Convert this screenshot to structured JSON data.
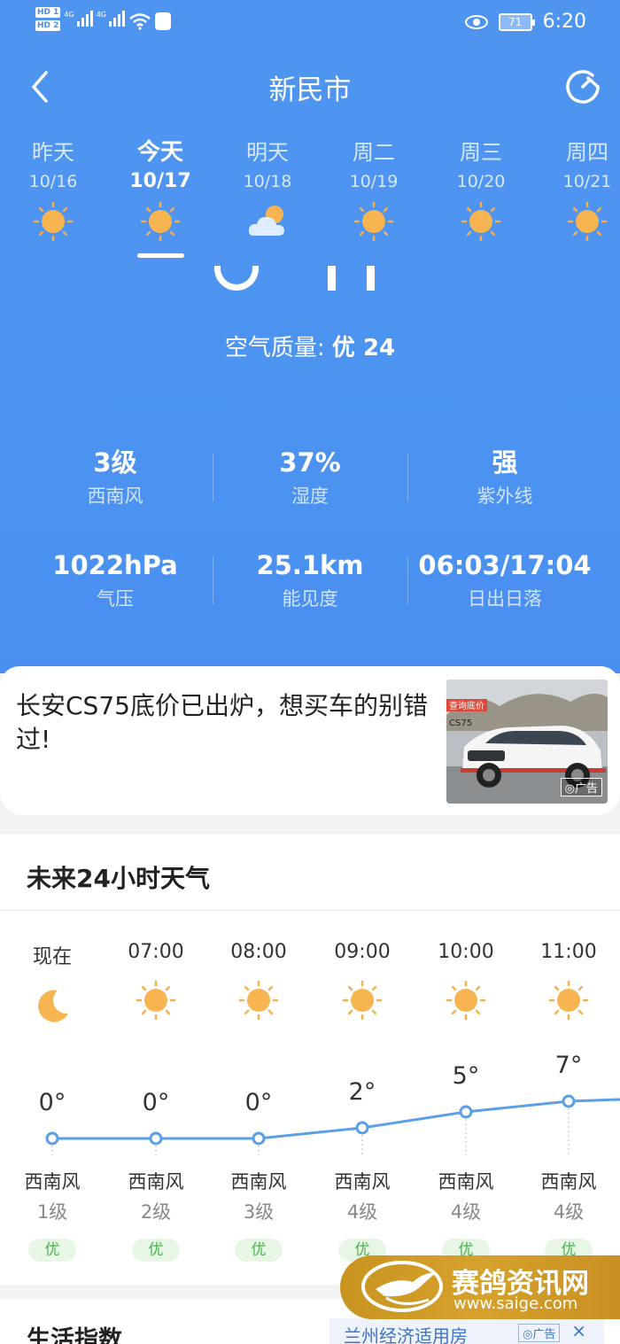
{
  "status_bar": {
    "hd1": "HD 1",
    "hd2": "HD 2",
    "net1": "4G",
    "net2": "4G",
    "battery": "71",
    "time": "6:20"
  },
  "header": {
    "city": "新民市"
  },
  "days": [
    {
      "name": "昨天",
      "date": "10/16",
      "icon": "sun-icon"
    },
    {
      "name": "今天",
      "date": "10/17",
      "icon": "sun-icon",
      "selected": true
    },
    {
      "name": "明天",
      "date": "10/18",
      "icon": "partly-cloudy-icon"
    },
    {
      "name": "周二",
      "date": "10/19",
      "icon": "sun-icon"
    },
    {
      "name": "周三",
      "date": "10/20",
      "icon": "sun-icon"
    },
    {
      "name": "周四",
      "date": "10/21",
      "icon": "sun-icon"
    }
  ],
  "air_quality": {
    "label": "空气质量:",
    "value": "优 24"
  },
  "details": [
    {
      "value": "3级",
      "label": "西南风"
    },
    {
      "value": "37%",
      "label": "湿度"
    },
    {
      "value": "强",
      "label": "紫外线"
    },
    {
      "value": "1022hPa",
      "label": "气压"
    },
    {
      "value": "25.1km",
      "label": "能见度"
    },
    {
      "value": "06:03/17:04",
      "label": "日出日落"
    }
  ],
  "ad": {
    "text": "长安CS75底价已出炉，想买车的别错过!",
    "image_tag": "广告",
    "image_caption": "查询底价",
    "image_model": "CS75"
  },
  "hourly": {
    "title": "未来24小时天气",
    "items": [
      {
        "time": "现在",
        "icon": "moon-icon",
        "temp": "0°",
        "temp_value": 0,
        "wind": "西南风",
        "level": "1级",
        "aqi": "优"
      },
      {
        "time": "07:00",
        "icon": "sun-icon",
        "temp": "0°",
        "temp_value": 0,
        "wind": "西南风",
        "level": "2级",
        "aqi": "优"
      },
      {
        "time": "08:00",
        "icon": "sun-icon",
        "temp": "0°",
        "temp_value": 0,
        "wind": "西南风",
        "level": "3级",
        "aqi": "优"
      },
      {
        "time": "09:00",
        "icon": "sun-icon",
        "temp": "2°",
        "temp_value": 2,
        "wind": "西南风",
        "level": "4级",
        "aqi": "优"
      },
      {
        "time": "10:00",
        "icon": "sun-icon",
        "temp": "5°",
        "temp_value": 5,
        "wind": "西南风",
        "level": "4级",
        "aqi": "优"
      },
      {
        "time": "11:00",
        "icon": "sun-icon",
        "temp": "7°",
        "temp_value": 7,
        "wind": "西南风",
        "level": "4级",
        "aqi": "优"
      }
    ]
  },
  "life": {
    "title": "生活指数",
    "ad_text": "兰州经济适用房",
    "ad_tag": "广告",
    "ad_close": "×"
  },
  "watermark": {
    "name": "赛鸽资讯网",
    "url": "www.saige.com"
  },
  "colors": {
    "header_bg": "#4d94f1",
    "sun": "#f7b552",
    "line": "#5b9fe6",
    "aqi_good": "#4caf50",
    "watermark": "#d6a12c"
  }
}
